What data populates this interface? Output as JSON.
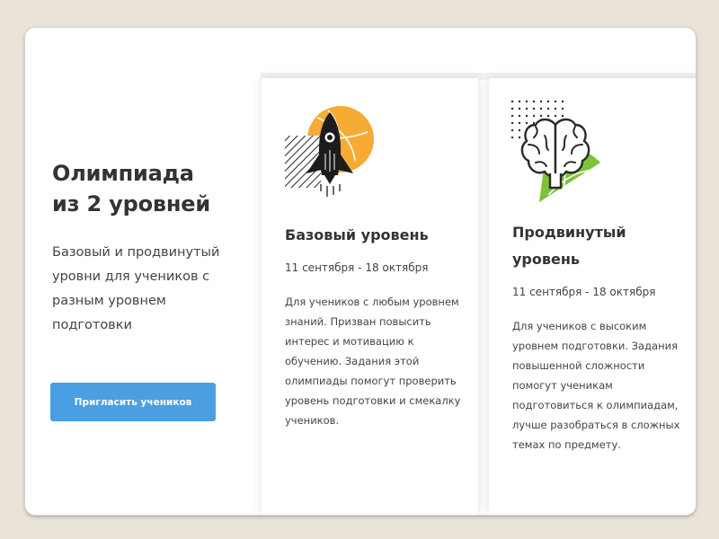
{
  "intro": {
    "title": "Олимпиада\nиз 2 уровней",
    "description": "Базовый и продвинутый уровни для учеников с разным уровнем подготовки",
    "invite_button_label": "Пригласить учеников"
  },
  "cards": [
    {
      "icon": "rocket-icon",
      "title": "Базовый уровень",
      "dates": "11 сентября - 18 октября",
      "description": "Для учеников с любым уровнем знаний. Призван повысить интерес и мотивацию к обучению. Задания этой олимпиады помогут проверить уровень подготовки и смекалку учеников."
    },
    {
      "icon": "brain-icon",
      "title": "Продвинутый уровень",
      "dates": "11 сентября - 18 октября",
      "description": "Для учеников с высоким уровнем подготовки. Задания повышенной сложности помогут ученикам подготовиться к олимпиадам, лучше разобраться в сложных темах по предмету."
    }
  ],
  "colors": {
    "accent_button": "#4a9fe3",
    "orange_circle": "#f6ab35",
    "green_shape": "#7ec13a",
    "text_dark": "#333333",
    "background": "#e9e3da"
  }
}
